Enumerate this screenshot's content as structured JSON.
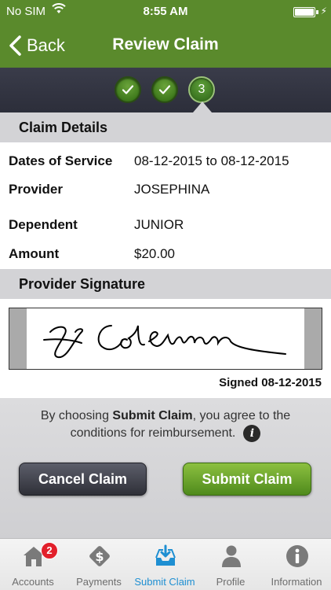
{
  "status_bar": {
    "carrier": "No SIM",
    "time": "8:55 AM"
  },
  "nav": {
    "back_label": "Back",
    "title": "Review Claim"
  },
  "stepper": {
    "steps": [
      {
        "state": "complete",
        "icon": "check-icon"
      },
      {
        "state": "complete",
        "icon": "check-icon"
      },
      {
        "state": "current",
        "label": "3"
      }
    ]
  },
  "claim_details": {
    "header": "Claim Details",
    "rows": [
      {
        "label": "Dates of Service",
        "value": "08-12-2015 to 08-12-2015"
      },
      {
        "label": "Provider",
        "value": "JOSEPHINA"
      },
      {
        "label": "Dependent",
        "value": "JUNIOR"
      },
      {
        "label": "Amount",
        "value": "$20.00"
      }
    ]
  },
  "signature": {
    "header": "Provider Signature",
    "signed_text": "Signed 08-12-2015"
  },
  "disclaimer": {
    "prefix": "By choosing ",
    "emphasis": "Submit Claim",
    "suffix": ", you agree to the conditions for reimbursement.",
    "info_icon": "i"
  },
  "actions": {
    "cancel_label": "Cancel Claim",
    "submit_label": "Submit Claim"
  },
  "tabs": [
    {
      "label": "Accounts",
      "icon": "home-icon",
      "badge": "2",
      "active": false
    },
    {
      "label": "Payments",
      "icon": "payments-icon",
      "active": false
    },
    {
      "label": "Submit Claim",
      "icon": "submit-claim-icon",
      "active": true
    },
    {
      "label": "Profile",
      "icon": "profile-icon",
      "active": false
    },
    {
      "label": "Information",
      "icon": "info-icon",
      "active": false
    }
  ],
  "colors": {
    "brand_green": "#5a8a2c",
    "submit_green": "#6ea62e",
    "tab_active": "#1e8fd2",
    "badge_red": "#e2202b"
  }
}
